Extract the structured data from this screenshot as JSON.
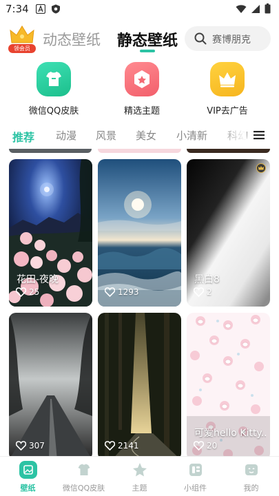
{
  "status_bar": {
    "time": "7:34",
    "left_icons": [
      "a-notification-icon",
      "shield-notification-icon"
    ],
    "right_icons": [
      "wifi-icon",
      "signal-icon",
      "battery-icon"
    ]
  },
  "header": {
    "vip_badge_label": "领会员",
    "tabs": [
      {
        "label": "动态壁纸",
        "active": false
      },
      {
        "label": "静态壁纸",
        "active": true
      }
    ],
    "search_placeholder": "赛博朋克"
  },
  "quick_entries": [
    {
      "label": "微信QQ皮肤",
      "icon": "tshirt-icon",
      "color": "#2ed0a0"
    },
    {
      "label": "精选主题",
      "icon": "hexagon-star-icon",
      "color": "#f5707a"
    },
    {
      "label": "VIP去广告",
      "icon": "crown-icon",
      "color": "#f8c02a"
    }
  ],
  "categories": [
    {
      "label": "推荐",
      "active": true
    },
    {
      "label": "动漫",
      "active": false
    },
    {
      "label": "风景",
      "active": false
    },
    {
      "label": "美女",
      "active": false
    },
    {
      "label": "小清新",
      "active": false
    },
    {
      "label": "科幻",
      "active": false
    }
  ],
  "wallpapers": [
    {
      "title": "花田-夜晚",
      "likes": "25",
      "vip": false
    },
    {
      "title": "",
      "likes": "1293",
      "vip": false
    },
    {
      "title": "黑白8",
      "likes": "2",
      "vip": true
    },
    {
      "title": "",
      "likes": "307",
      "vip": false
    },
    {
      "title": "",
      "likes": "2141",
      "vip": false
    },
    {
      "title": "可爱hello Kitty...",
      "likes": "20",
      "vip": false
    }
  ],
  "bottom_nav": [
    {
      "label": "壁纸",
      "icon": "wallpaper-icon",
      "active": true
    },
    {
      "label": "微信QQ皮肤",
      "icon": "tshirt-icon",
      "active": false
    },
    {
      "label": "主题",
      "icon": "theme-icon",
      "active": false
    },
    {
      "label": "小组件",
      "icon": "widget-icon",
      "active": false
    },
    {
      "label": "我的",
      "icon": "profile-icon",
      "active": false
    }
  ],
  "colors": {
    "accent": "#2cc3a4",
    "vip_red": "#e8432f",
    "inactive_text": "#888888"
  }
}
